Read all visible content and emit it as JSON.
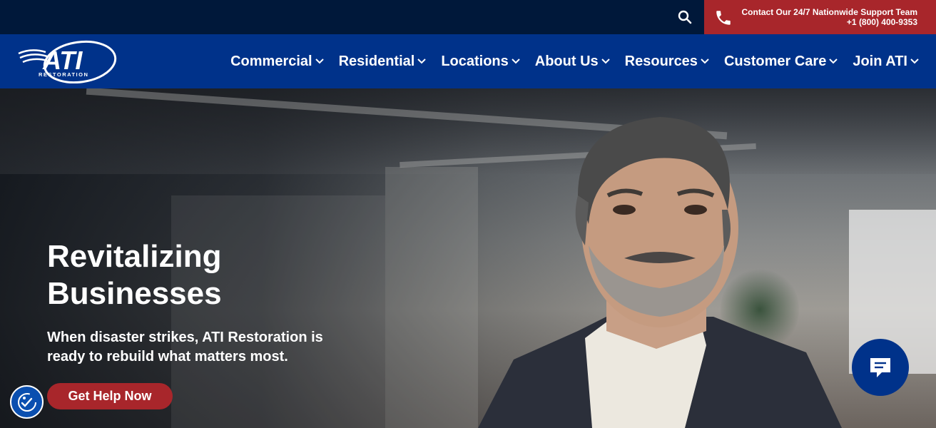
{
  "topbar": {
    "search_icon": "search-icon",
    "contact_line1": "Contact Our 24/7 Nationwide Support Team",
    "contact_line2": "+1 (800) 400-9353",
    "phone_icon": "phone-icon"
  },
  "logo": {
    "text": "ATI",
    "subtext": "RESTORATION"
  },
  "nav": {
    "items": [
      {
        "label": "Commercial"
      },
      {
        "label": "Residential"
      },
      {
        "label": "Locations"
      },
      {
        "label": "About Us"
      },
      {
        "label": "Resources"
      },
      {
        "label": "Customer Care"
      },
      {
        "label": "Join ATI"
      }
    ]
  },
  "hero": {
    "title": "Revitalizing Businesses",
    "subtitle": "When disaster strikes, ATI Restoration is ready to rebuild what matters most.",
    "cta_label": "Get Help Now"
  },
  "colors": {
    "topbar_bg": "#00183a",
    "nav_bg": "#00328a",
    "accent_red": "#a8262b"
  },
  "widgets": {
    "accessibility_icon": "accessibility-icon",
    "chat_icon": "chat-icon"
  }
}
